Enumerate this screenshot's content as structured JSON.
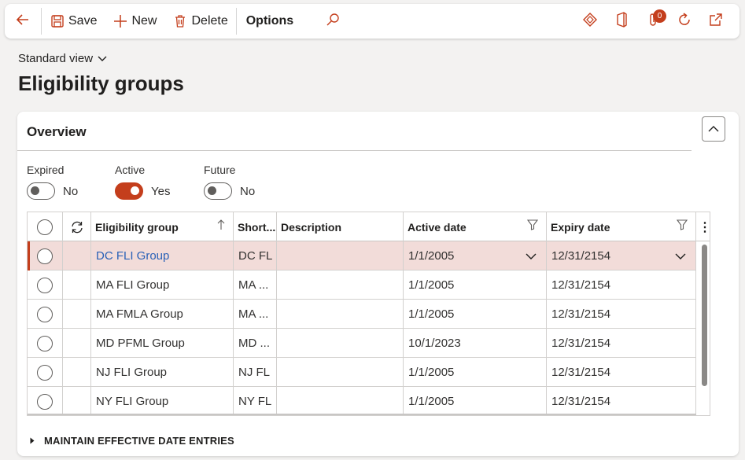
{
  "toolbar": {
    "save_label": "Save",
    "new_label": "New",
    "delete_label": "Delete",
    "options_label": "Options",
    "attachments_count": "0"
  },
  "view": {
    "selector_label": "Standard view"
  },
  "page": {
    "title": "Eligibility groups"
  },
  "overview": {
    "title": "Overview",
    "filters": [
      {
        "label": "Expired",
        "value": "No",
        "on": false
      },
      {
        "label": "Active",
        "value": "Yes",
        "on": true
      },
      {
        "label": "Future",
        "value": "No",
        "on": false
      }
    ]
  },
  "grid": {
    "columns": [
      "Eligibility group",
      "Short...",
      "Description",
      "Active date",
      "Expiry date"
    ],
    "rows": [
      {
        "group": "DC FLI Group",
        "short": "DC FL",
        "description": "",
        "active_date": "1/1/2005",
        "expiry_date": "12/31/2154",
        "selected": true
      },
      {
        "group": "MA FLI Group",
        "short": "MA ...",
        "description": "",
        "active_date": "1/1/2005",
        "expiry_date": "12/31/2154",
        "selected": false
      },
      {
        "group": "MA FMLA Group",
        "short": "MA ...",
        "description": "",
        "active_date": "1/1/2005",
        "expiry_date": "12/31/2154",
        "selected": false
      },
      {
        "group": "MD PFML Group",
        "short": "MD ...",
        "description": "",
        "active_date": "10/1/2023",
        "expiry_date": "12/31/2154",
        "selected": false
      },
      {
        "group": "NJ FLI Group",
        "short": "NJ FL",
        "description": "",
        "active_date": "1/1/2005",
        "expiry_date": "12/31/2154",
        "selected": false
      },
      {
        "group": "NY FLI Group",
        "short": "NY FL",
        "description": "",
        "active_date": "1/1/2005",
        "expiry_date": "12/31/2154",
        "selected": false
      }
    ]
  },
  "section": {
    "label": "MAINTAIN EFFECTIVE DATE ENTRIES"
  },
  "colors": {
    "accent": "#c43e1c",
    "link": "#2a61b7",
    "selected_row": "#f2dcd9"
  },
  "icons": [
    "back-arrow-icon",
    "save-icon",
    "plus-icon",
    "trash-icon",
    "search-icon",
    "diamond-icon",
    "office-icon",
    "attachment-icon",
    "refresh-icon",
    "popout-icon"
  ]
}
